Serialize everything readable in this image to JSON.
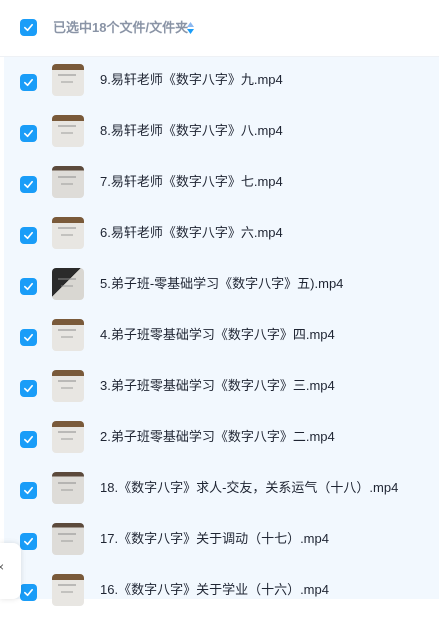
{
  "header": {
    "selection_text": "已选中18个文件/文件夹"
  },
  "files": [
    {
      "name": "9.易轩老师《数字八字》九.mp4",
      "checked": true
    },
    {
      "name": "8.易轩老师《数字八字》八.mp4",
      "checked": true
    },
    {
      "name": "7.易轩老师《数字八字》七.mp4",
      "checked": true
    },
    {
      "name": "6.易轩老师《数字八字》六.mp4",
      "checked": true
    },
    {
      "name": "5.弟子班-零基础学习《数字八字》五).mp4",
      "checked": true
    },
    {
      "name": "4.弟子班零基础学习《数字八字》四.mp4",
      "checked": true
    },
    {
      "name": "3.弟子班零基础学习《数字八字》三.mp4",
      "checked": true
    },
    {
      "name": "2.弟子班零基础学习《数字八字》二.mp4",
      "checked": true
    },
    {
      "name": "18.《数字八字》求人-交友，关系运气（十八）.mp4",
      "checked": true
    },
    {
      "name": "17.《数字八字》关于调动（十七）.mp4",
      "checked": true
    },
    {
      "name": "16.《数字八字》关于学业（十六）.mp4",
      "checked": true
    }
  ],
  "side_panel": {
    "close_glyph": "×"
  },
  "colors": {
    "accent": "#1a9df8",
    "list_bg": "#f2f8fe"
  }
}
